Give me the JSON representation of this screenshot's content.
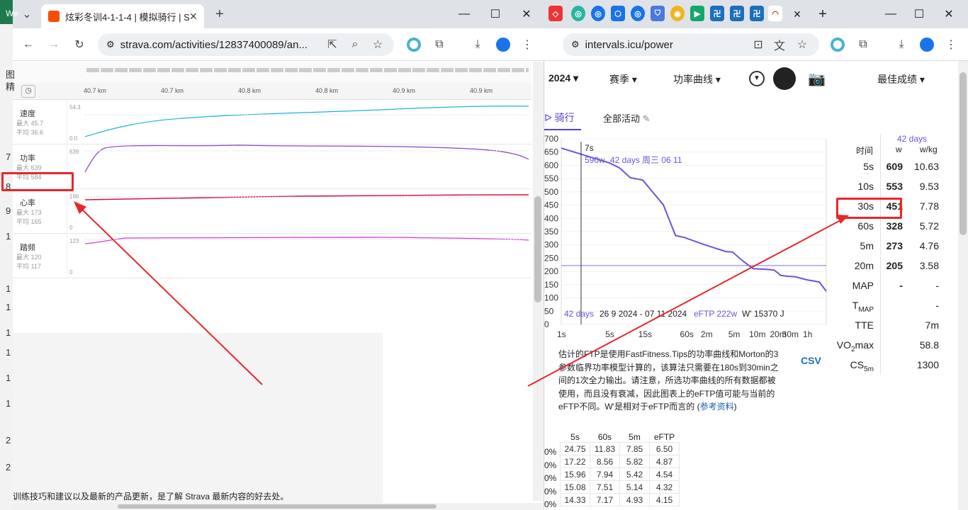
{
  "left_browser": {
    "tab_title": "炫彩冬训4-1-1-4 | 模拟骑行 | S",
    "url": "strava.com/activities/12837400089/an...",
    "distance_ticks": [
      "40.7 km",
      "40.7 km",
      "40.8 km",
      "40.8 km",
      "40.9 km",
      "40.9 km"
    ],
    "rows": [
      {
        "label": "速度",
        "max": "最大 45.7",
        "avg": "平均 36.6",
        "scale_top": "54.3",
        "scale_bottom": "0.0"
      },
      {
        "label": "功率",
        "max": "最大 639",
        "avg": "平均 584",
        "scale_top": "639",
        "scale_bottom": ""
      },
      {
        "label": "心率",
        "max": "最大 173",
        "avg": "平均 165",
        "scale_top": "186",
        "scale_bottom": "0"
      },
      {
        "label": "踏频",
        "max": "最大 120",
        "avg": "平均 117",
        "scale_top": "123",
        "scale_bottom": "0"
      }
    ],
    "footer_text": "训练技巧和建议以及最新的产品更新，是了解 Strava 最新内容的好去处。",
    "side_fragments": [
      "We",
      "图",
      "精",
      "7",
      "8",
      "9",
      "1",
      "1",
      "1",
      "1",
      "1",
      "1",
      "1",
      "2",
      "2"
    ]
  },
  "right_browser": {
    "url": "intervals.icu/power",
    "nav": {
      "year": "2024",
      "season": "赛季",
      "curve": "功率曲线",
      "best": "最佳成绩"
    },
    "tabs": {
      "ride": "骑行",
      "all": "全部活动"
    },
    "chart_data": {
      "type": "line",
      "x_ticks": [
        "1s",
        "5s",
        "15s",
        "60s",
        "2m",
        "5m",
        "10m",
        "20m",
        "30m",
        "1h"
      ],
      "y_ticks": [
        "700",
        "650",
        "600",
        "550",
        "500",
        "450",
        "400",
        "350",
        "300",
        "250",
        "200",
        "150",
        "100",
        "50",
        "0"
      ],
      "ylim": [
        0,
        700
      ],
      "series": [
        {
          "name": "42 days",
          "values": [
            {
              "x": "1s",
              "y": 665
            },
            {
              "x": "5s",
              "y": 609
            },
            {
              "x": "7s",
              "y": 590
            },
            {
              "x": "10s",
              "y": 553
            },
            {
              "x": "15s",
              "y": 545
            },
            {
              "x": "30s",
              "y": 451
            },
            {
              "x": "45s",
              "y": 335
            },
            {
              "x": "60s",
              "y": 328
            },
            {
              "x": "2m",
              "y": 300
            },
            {
              "x": "4m",
              "y": 275
            },
            {
              "x": "5m",
              "y": 273
            },
            {
              "x": "7m",
              "y": 240
            },
            {
              "x": "10m",
              "y": 210
            },
            {
              "x": "15m",
              "y": 208
            },
            {
              "x": "20m",
              "y": 205
            },
            {
              "x": "25m",
              "y": 185
            },
            {
              "x": "30m",
              "y": 182
            },
            {
              "x": "40m",
              "y": 180
            },
            {
              "x": "1h",
              "y": 168
            },
            {
              "x": "1h30",
              "y": 160
            },
            {
              "x": "end",
              "y": 125
            }
          ]
        }
      ],
      "eftp_line": 222,
      "cursor": {
        "time": "7s",
        "value": "590w",
        "period": "42 days",
        "day": "周三 06 11"
      },
      "footer": {
        "period": "42 days",
        "dates": "26 9 2024 - 07 11 2024",
        "eftp": "eFTP 222w",
        "wprime": "W' 15370 J"
      }
    },
    "best_table": {
      "header_period": "42 days",
      "col_time": "时间",
      "col_w": "w",
      "col_wkg": "w/kg",
      "rows": [
        {
          "t": "5s",
          "w": "609",
          "wkg": "10.63"
        },
        {
          "t": "10s",
          "w": "553",
          "wkg": "9.53"
        },
        {
          "t": "30s",
          "w": "451",
          "wkg": "7.78"
        },
        {
          "t": "60s",
          "w": "328",
          "wkg": "5.72"
        },
        {
          "t": "5m",
          "w": "273",
          "wkg": "4.76"
        },
        {
          "t": "20m",
          "w": "205",
          "wkg": "3.58"
        },
        {
          "t": "MAP",
          "w": "-",
          "wkg": "-"
        },
        {
          "t": "TMAP",
          "w": "",
          "wkg": "-"
        },
        {
          "t": "TTE",
          "w": "",
          "wkg": "7m"
        },
        {
          "t": "VO2max",
          "w": "",
          "wkg": "58.8"
        },
        {
          "t": "CS5m",
          "w": "",
          "wkg": "1300"
        }
      ]
    },
    "description": "估计的FTP是使用FastFitness.Tips的功率曲线和Morton的3参数临界功率模型计算的，该算法只需要在180s到30min之间的1次全力输出。请注意，所选功率曲线的所有数据都被使用，而且没有衰减，因此图表上的eFTP值可能与当前的eFTP不同。W'是相对于eFTP而言的",
    "ref_link": "参考资料",
    "csv": "CSV",
    "wkg_table": {
      "headers": [
        "5s",
        "60s",
        "5m",
        "eFTP"
      ],
      "rows": [
        [
          "24.75",
          "11.83",
          "7.85",
          "6.50"
        ],
        [
          "17.22",
          "8.56",
          "5.82",
          "4.87"
        ],
        [
          "15.96",
          "7.94",
          "5.42",
          "4.54"
        ],
        [
          "15.08",
          "7.51",
          "5.14",
          "4.32"
        ],
        [
          "14.33",
          "7.17",
          "4.93",
          "4.15"
        ]
      ],
      "row_prefix": "0%"
    }
  }
}
